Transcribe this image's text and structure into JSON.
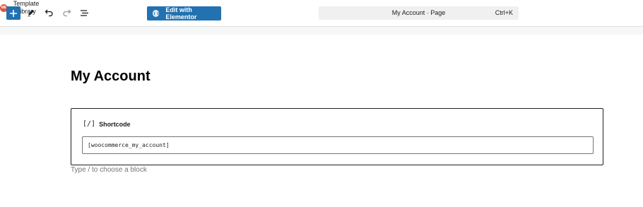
{
  "toolbar": {
    "inserter_icon": "plus-icon",
    "tools_icon": "pencil-icon",
    "undo_icon": "undo-icon",
    "redo_icon": "redo-icon",
    "list_view_icon": "list-view-icon",
    "template_library": {
      "logo_text": "ME",
      "label_line1": "Template",
      "label_line2": "Library"
    },
    "elementor_button_label": "Edit with Elementor",
    "command_bar": {
      "title": "My Account · Page",
      "shortcut": "Ctrl+K"
    },
    "accent_color": "#2271b1"
  },
  "editor": {
    "page_title": "My Account",
    "shortcode_block": {
      "icon": "[/]",
      "label": "Shortcode",
      "value": "[woocommerce_my_account]"
    },
    "appender_placeholder": "Type / to choose a block"
  }
}
